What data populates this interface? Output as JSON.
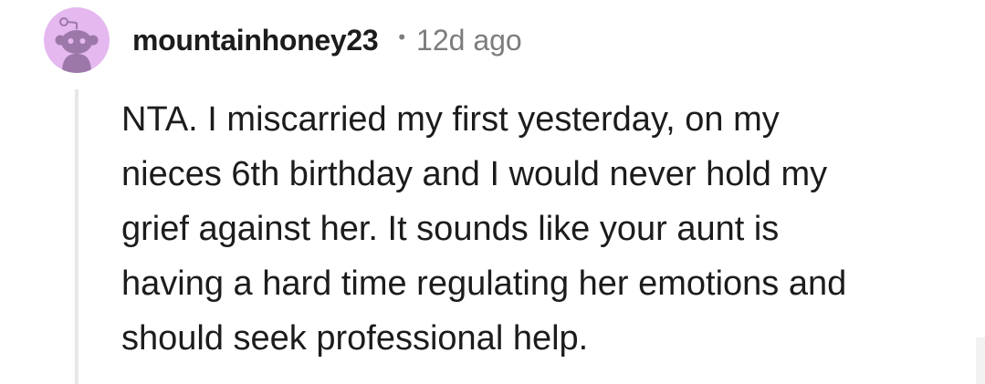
{
  "comment": {
    "author": "mountainhoney23",
    "separator": "•",
    "time_ago": "12d ago",
    "avatar": {
      "icon": "reddit-snoo-avatar-icon",
      "background_color": "#e5b8f0",
      "figure_color": "#9b78a8"
    },
    "body_lines": [
      "NTA. I miscarried my first yesterday, on my",
      "nieces 6th birthday and I would never hold my",
      "grief against her. It sounds like your aunt is",
      "having a hard time regulating her emotions and",
      "should seek professional help."
    ]
  }
}
